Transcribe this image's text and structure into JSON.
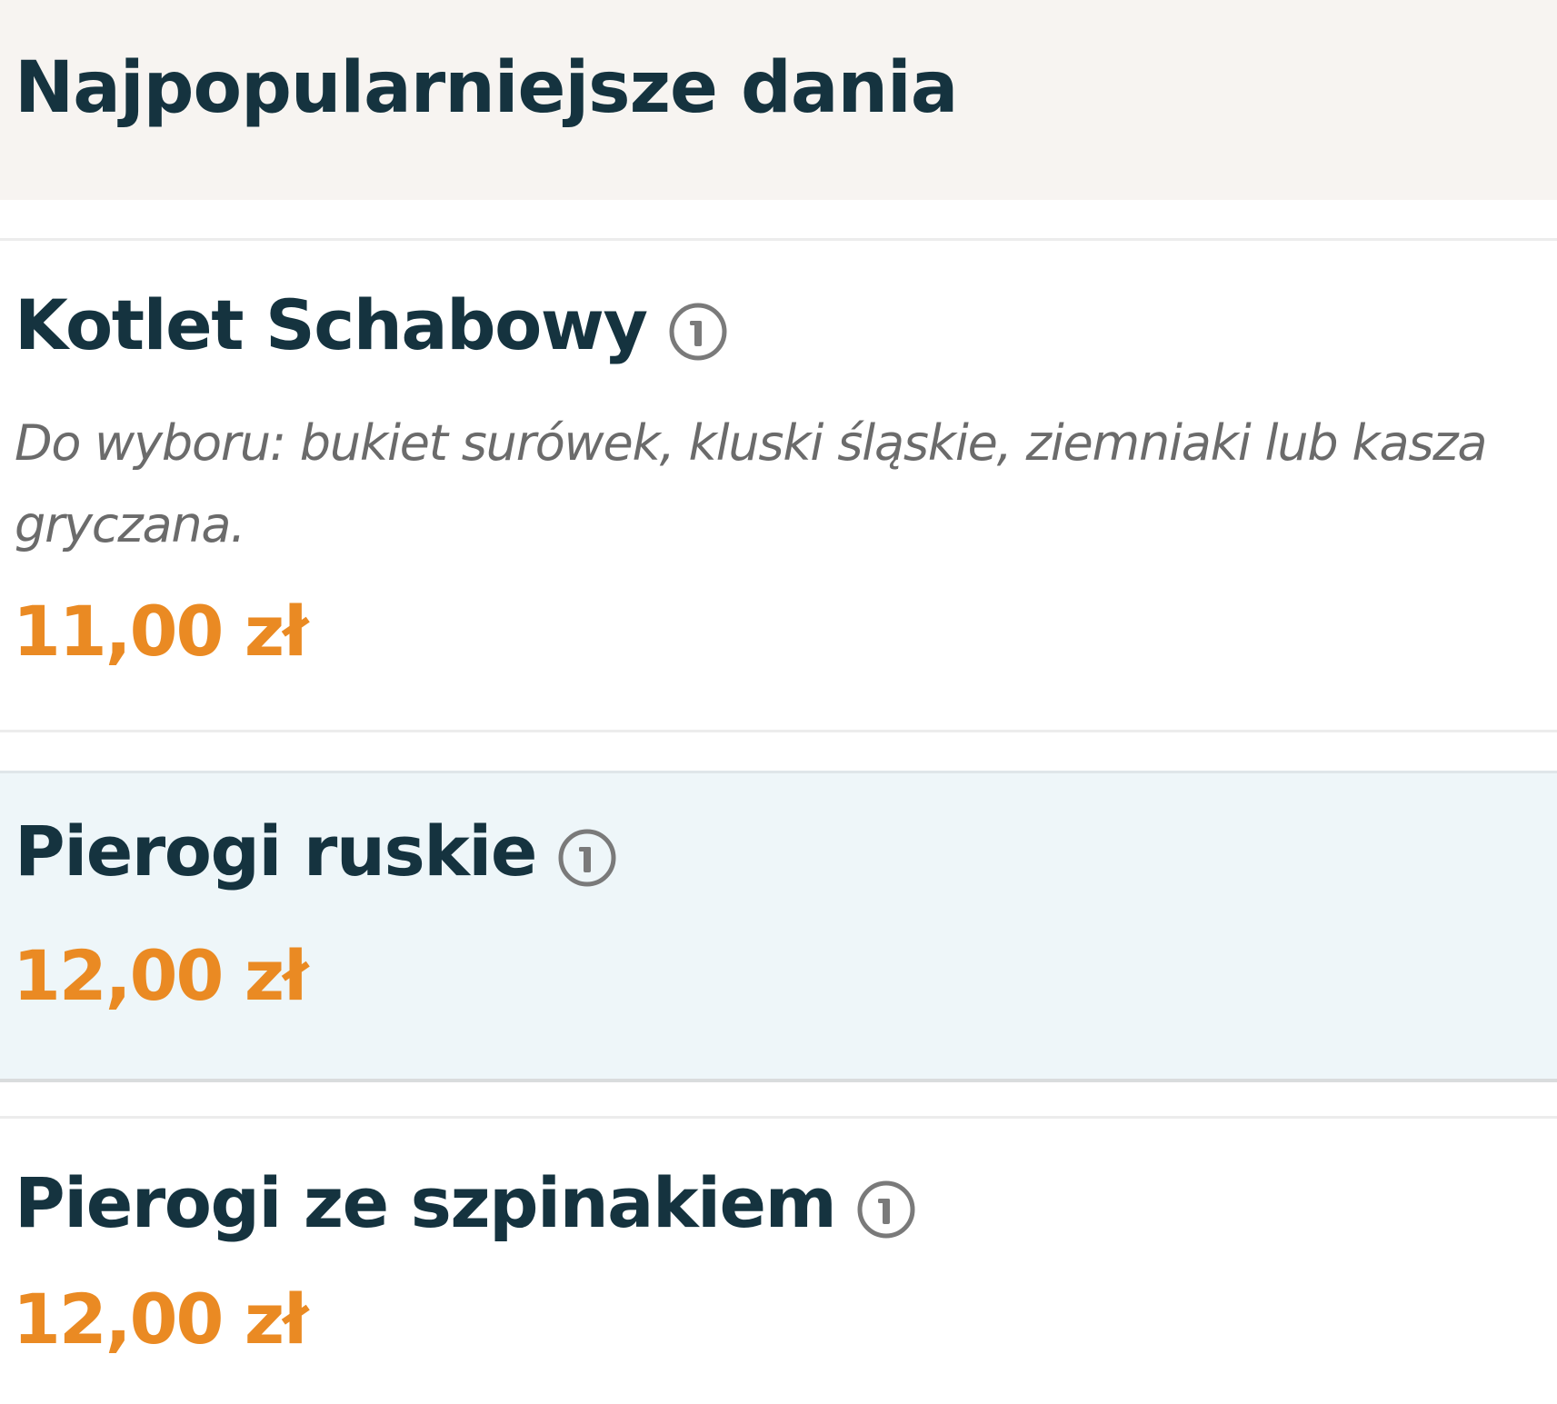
{
  "section": {
    "title": "Najpopularniejsze dania"
  },
  "dishes": [
    {
      "name": "Kotlet Schabowy",
      "description": "Do wyboru: bukiet surówek, kluski śląskie, ziemniaki lub kasza gryczana.",
      "price": "11,00 zł",
      "info_icon": "info-circle-icon"
    },
    {
      "name": "Pierogi ruskie",
      "price": "12,00 zł",
      "info_icon": "info-circle-icon",
      "highlighted": true
    },
    {
      "name": "Pierogi ze szpinakiem",
      "price": "12,00 zł",
      "info_icon": "info-circle-icon"
    }
  ],
  "colors": {
    "title": "#15333f",
    "price": "#ea8a23",
    "description": "#6b6b6b",
    "header_bg": "#f7f4f1",
    "highlight_bg": "#eef6f9"
  }
}
